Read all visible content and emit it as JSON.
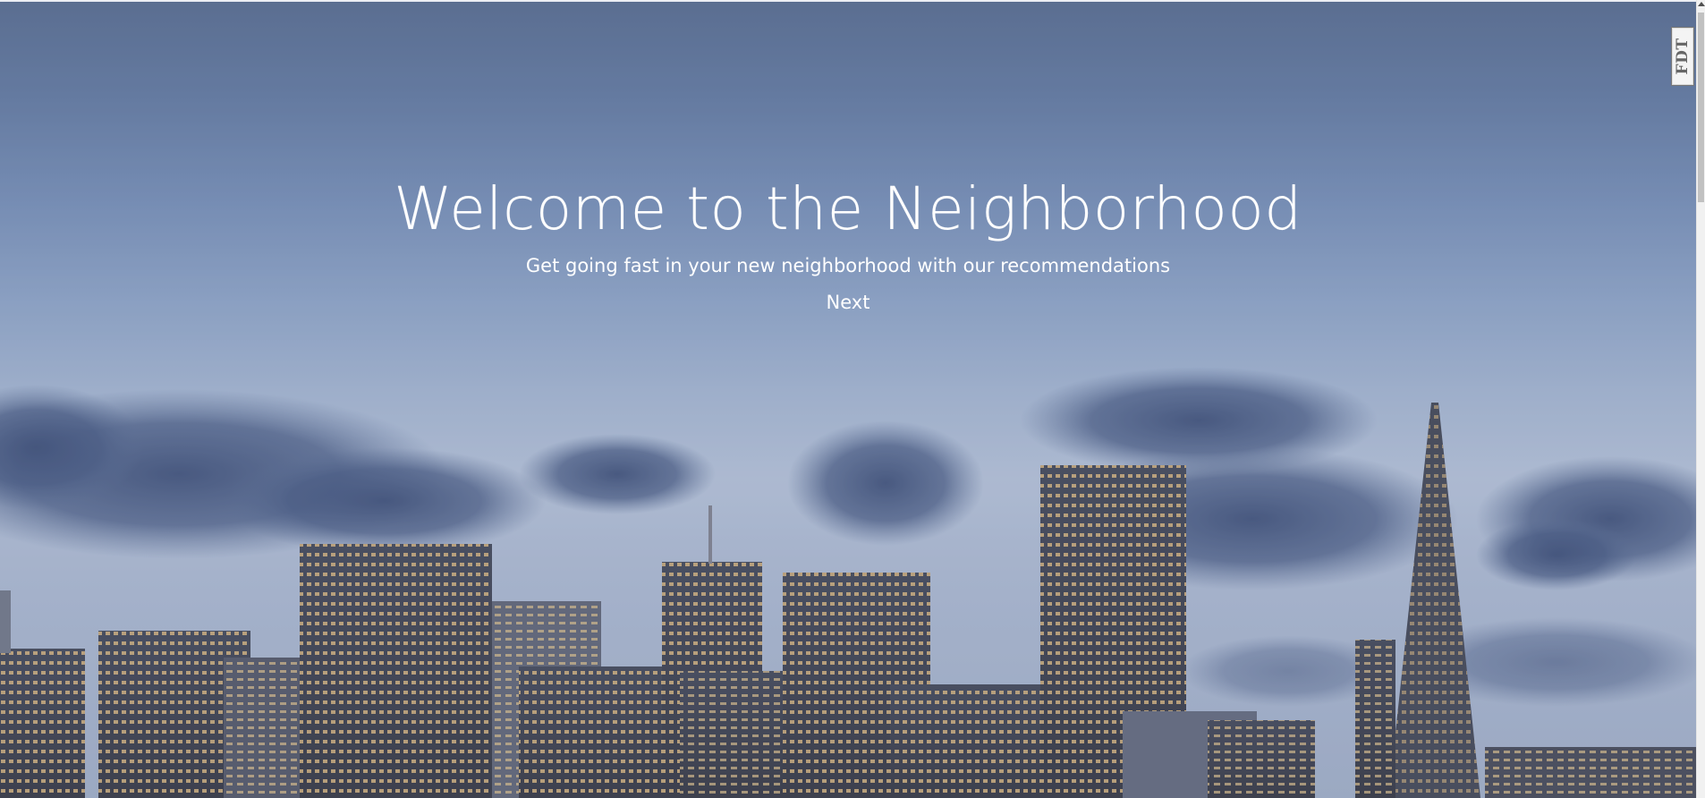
{
  "hero": {
    "headline": "Welcome to the Neighborhood",
    "subtitle": "Get going fast in your new neighborhood with our recommendations",
    "next_label": "Next",
    "background_image": "city-skyline-dusk"
  },
  "extension_badge": {
    "label": "FDT",
    "icon": "fdt-extension-icon"
  },
  "colors": {
    "text": "#ffffff",
    "sky_top": "#4f6386",
    "sky_mid": "#a3b3cd"
  }
}
